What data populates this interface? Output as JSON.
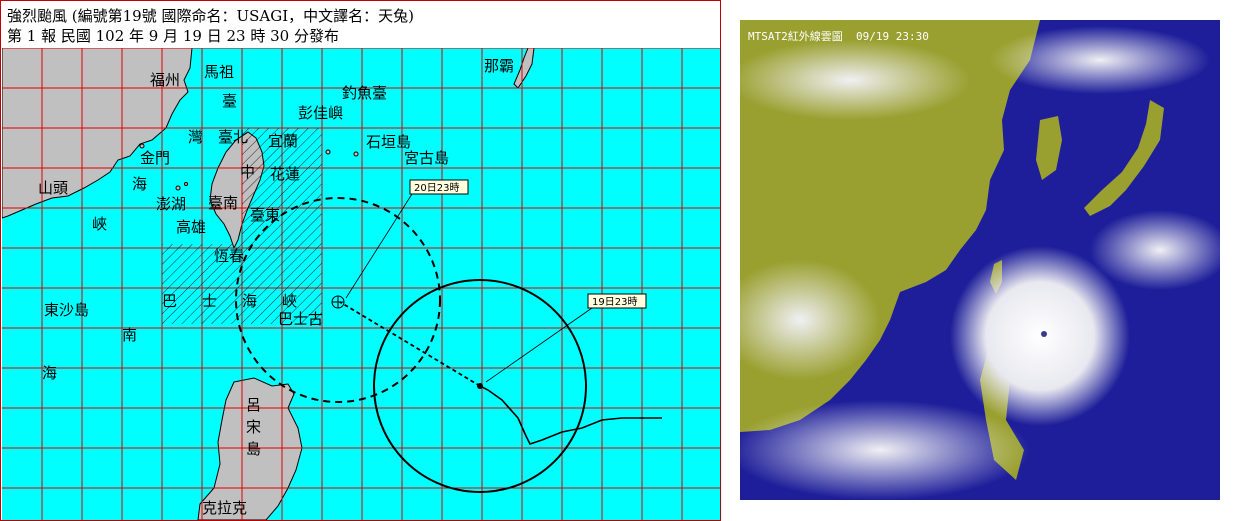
{
  "header": {
    "line1": "強烈颱風 (編號第19號 國際命名：USAGI，中文譯名：天兔)",
    "line2": "第 1 報 民國 102 年 9 月 19 日 23 時 30 分發布"
  },
  "map": {
    "colors": {
      "sea": "#00ffff",
      "land": "#c0c0c0",
      "grid": "#e00000",
      "coast": "#000000"
    },
    "place_labels": {
      "fuzhou": "福州",
      "mazu": "馬祖",
      "taiwan_tai": "臺",
      "wan": "灣",
      "taibei": "臺北",
      "yilan": "宜蘭",
      "diaoyutai": "釣魚臺",
      "pengjiayu": "彭佳嶼",
      "naba": "那霸",
      "shigaoki": "石垣島",
      "miyako": "宮古島",
      "jinmen": "金門",
      "hai1": "海",
      "zhong": "中",
      "hualian": "花蓮",
      "shantou": "山頭",
      "penghu": "澎湖",
      "tainan": "臺南",
      "xia": "峽",
      "gaoxiong": "高雄",
      "taidong": "臺東",
      "hengchun": "恆春",
      "ba": "巴",
      "shi": "士",
      "hai2": "海",
      "xia2": "峽",
      "batanes": "巴士古",
      "dongsha": "東沙島",
      "nan": "南",
      "hai3": "海",
      "luzon_lv": "呂",
      "luzon_song": "宋",
      "luzon_dao": "島",
      "kelake": "克拉克"
    },
    "track_tags": {
      "forecast": "20日23時",
      "current": "19日23時"
    }
  },
  "satellite": {
    "title": "MTSAT2紅外線雲圖  09/19 23:30",
    "colors": {
      "ocean": "#1e1e9a",
      "land": "#9aa030",
      "cloud": "#f4f4f4",
      "coast": "#d8c800"
    }
  }
}
